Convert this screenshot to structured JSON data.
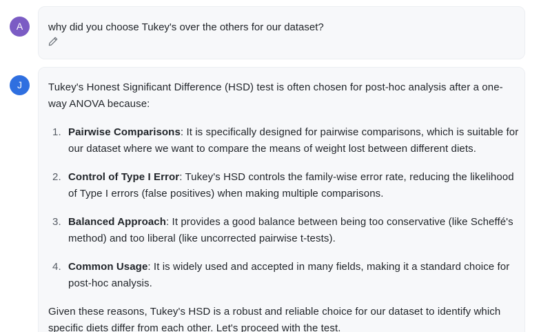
{
  "user_message": {
    "avatar_initial": "A",
    "text": "why did you choose Tukey's over the others for our dataset?",
    "edit_icon": "pencil-icon"
  },
  "assistant_message": {
    "avatar_initial": "J",
    "intro": "Tukey's Honest Significant Difference (HSD) test is often chosen for post-hoc analysis after a one-way ANOVA because:",
    "items": [
      {
        "number": "1.",
        "title": "Pairwise Comparisons",
        "text": ": It is specifically designed for pairwise comparisons, which is suitable for our dataset where we want to compare the means of weight lost between different diets."
      },
      {
        "number": "2.",
        "title": "Control of Type I Error",
        "text": ": Tukey's HSD controls the family-wise error rate, reducing the likelihood of Type I errors (false positives) when making multiple comparisons."
      },
      {
        "number": "3.",
        "title": "Balanced Approach",
        "text": ": It provides a good balance between being too conservative (like Scheffé's method) and too liberal (like uncorrected pairwise t-tests)."
      },
      {
        "number": "4.",
        "title": "Common Usage",
        "text": ": It is widely used and accepted in many fields, making it a standard choice for post-hoc analysis."
      }
    ],
    "conclusion": "Given these reasons, Tukey's HSD is a robust and reliable choice for our dataset to identify which specific diets differ from each other. Let's proceed with the test."
  },
  "colors": {
    "user_avatar": "#7b5cc4",
    "assistant_avatar": "#2f6fe0",
    "bubble_background": "#f7f8fa"
  }
}
